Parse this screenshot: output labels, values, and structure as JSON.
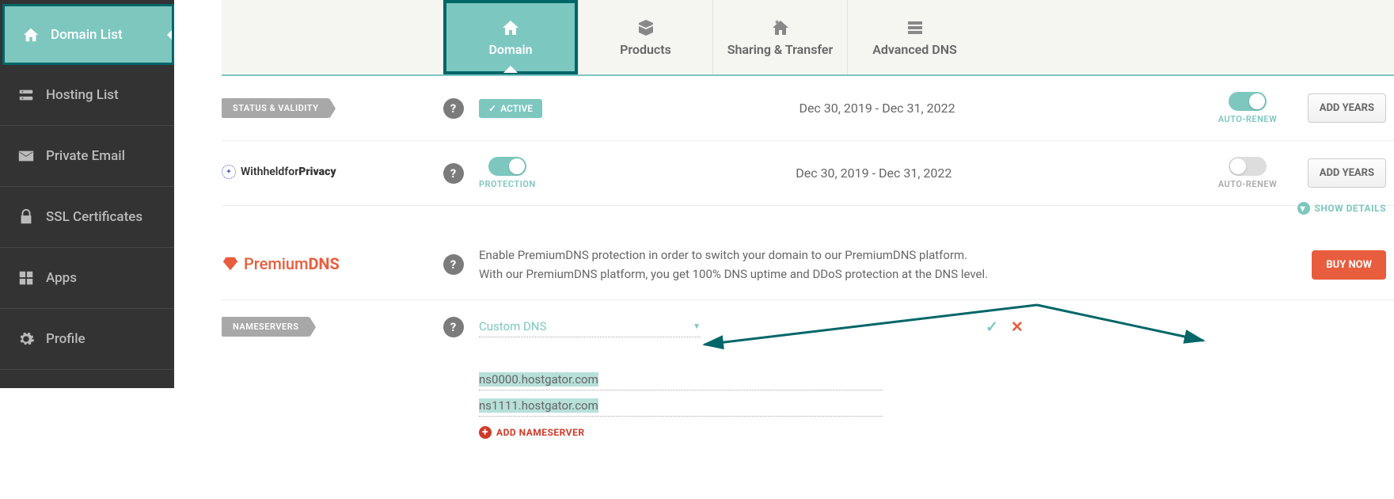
{
  "sidebar": {
    "items": [
      {
        "label": "Domain List",
        "icon": "house"
      },
      {
        "label": "Hosting List",
        "icon": "hosting"
      },
      {
        "label": "Private Email",
        "icon": "email"
      },
      {
        "label": "SSL Certificates",
        "icon": "lock"
      },
      {
        "label": "Apps",
        "icon": "apps"
      },
      {
        "label": "Profile",
        "icon": "gear"
      }
    ]
  },
  "tabs": {
    "items": [
      {
        "label": "Domain"
      },
      {
        "label": "Products"
      },
      {
        "label": "Sharing & Transfer"
      },
      {
        "label": "Advanced DNS"
      }
    ]
  },
  "status": {
    "badge_label": "STATUS & VALIDITY",
    "active_label": "ACTIVE",
    "date_range": "Dec 30, 2019 - Dec 31, 2022",
    "auto_renew_label": "AUTO-RENEW",
    "add_years_label": "ADD YEARS"
  },
  "privacy": {
    "brand_prefix": "Withheldfor",
    "brand_bold": "Privacy",
    "protection_label": "PROTECTION",
    "date_range": "Dec 30, 2019 - Dec 31, 2022",
    "auto_renew_label": "AUTO-RENEW",
    "add_years_label": "ADD YEARS",
    "show_details_label": "SHOW DETAILS"
  },
  "premium": {
    "brand_prefix": "Premium",
    "brand_bold": "DNS",
    "text_line1": "Enable PremiumDNS protection in order to switch your domain to our PremiumDNS platform.",
    "text_line2": "With our PremiumDNS platform, you get 100% DNS uptime and DDoS protection at the DNS level.",
    "buy_now_label": "BUY NOW"
  },
  "nameservers": {
    "badge_label": "NAMESERVERS",
    "dropdown_value": "Custom DNS",
    "entries": [
      "ns0000.hostgator.com",
      "ns1111.hostgator.com"
    ],
    "add_label": "ADD NAMESERVER"
  }
}
